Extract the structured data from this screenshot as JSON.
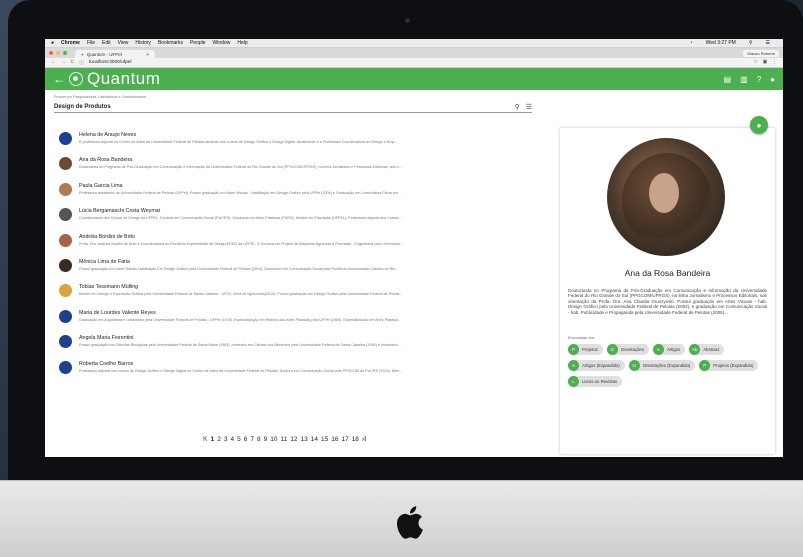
{
  "menubar": {
    "app": "Chrome",
    "items": [
      "File",
      "Edit",
      "View",
      "History",
      "Bookmarks",
      "People",
      "Window",
      "Help"
    ],
    "clock": "Wed 3:27 PM"
  },
  "browser": {
    "tab_title": "Quantum - UFPel",
    "profile_name": "Glauco Roberto",
    "url": "localhost:3000/ufpel"
  },
  "appbar": {
    "brand": "Quantum"
  },
  "search": {
    "label": "Procure por Pesquisadores, Laboratórios e Conhecimentos",
    "value": "Design de Produtos"
  },
  "results": [
    {
      "name": "Helena de Araujo Neves",
      "desc": "É professora adjunta no Centro de Artes da Universidade Federal de Pelotas atuando nos cursos de Design Gráfico e Design Digital. Atualmente é a Professora Coordenadora do Design e Emp...",
      "avatar": "#1f3f8f"
    },
    {
      "name": "Ana da Rosa Bandeira",
      "desc": "Doutoranda no Programa de Pós-Graduação em Comunicação e Informação da Universidade Federal do Rio Grande do Sul (PPGCOM/UFRGS), na linha Jornalismo e Processos Editoriais, sob o...",
      "avatar": "#6b4a35"
    },
    {
      "name": "Paula Garcia Lima",
      "desc": "Professora assistente da Universidade Federal de Pelotas (UFPel). Possui graduação em Artes Visuais - Habilitação em Design Gráfico pela UFPel (2004) e Graduação em Licenciatura Plena em...",
      "avatar": "#b07a55"
    },
    {
      "name": "Lúcia Bergamaschi Costa Weymar",
      "desc": "Coordenadora dos Cursos de Design da UFPEL. Doutora em Comunicação Social (PUCRS). Graduada em Artes Plásticas (FURG). Mestre em Educação (UFPEL). Professora adjunta dos Cursos ...",
      "avatar": "#555555"
    },
    {
      "name": "Andréia Bordini de Brito",
      "desc": "Profa. Dra. Andréia Bordini de Brito é Coordenadora do Escritório experimental de Design-EEDG da UFPEL. É Doutora em Projeto de Máquinas Agrícolas e Florestais - Engenharia pela Universida...",
      "avatar": "#a8644a"
    },
    {
      "name": "Mônica Lima de Faria",
      "desc": "Possui graduação em Artes Visuais Habilitação Em Design Gráfico pela Universidade Federal de Pelotas (2004), Doutorado em Comunicação Social pela Pontifícia Universidade Católica do Rio...",
      "avatar": "#3a2a24"
    },
    {
      "name": "Tobias Tessmann Mülling",
      "desc": "Mestre em Design e Expressão Gráfica pela Universidade Federal de Santa Catarina - UFSC, linha de hipermídia(2010). Possui graduação em Design Gráfico pela Universidade Federal de Pelota...",
      "avatar": "#d9a23c"
    },
    {
      "name": "Maria de Lourdes Valente Reyes",
      "desc": "Graduação em Arquitetura e Urbanismo pela Universidade Federal de Pelotas - UFPel (1978), Especialização em História das Artes Plásticas pela UFPel (1980), Especialização em Artes Plástica...",
      "avatar": "#1f3f8f"
    },
    {
      "name": "Angela Maria Fiorentini",
      "desc": "Possui graduação em Ciências Biológicas pela Universidade Federal de Santa Maria (1983), mestrado em Ciência dos Alimentos pela Universidade Federal de Santa Catarina (1999) e doutorado...",
      "avatar": "#1f3f8f"
    },
    {
      "name": "Roberta Coelho Barros",
      "desc": "Professora adjunta nos cursos de Design Gráfico e Design Digital do Centro de Artes da Universidade Federal de Pelotas. Doutora em Comunicação Social pela PPGCOM da PUCRS (2013). Mes...",
      "avatar": "#1f3f8f"
    }
  ],
  "pagination": {
    "first": "K",
    "pages": [
      "1",
      "2",
      "3",
      "4",
      "5",
      "6",
      "7",
      "8",
      "9",
      "10",
      "11",
      "12",
      "13",
      "14",
      "15",
      "16",
      "17",
      "18"
    ],
    "last": "›I"
  },
  "profile": {
    "name": "Ana da Rosa Bandeira",
    "description": "Doutoranda no Programa de Pós-Graduação em Comunicação e Informação da Universidade Federal do Rio Grande do Sul (PPGCOM/UFRGS), na linha Jornalismo e Processos Editoriais, sob orientação da Profa. Dra. Ana Claudia Gruszynski. Possui graduação em Artes Visuais - hab. Design Gráfico pela Universidade Federal de Pelotas (2002), e graduação em Comunicação Social - hab. Publicidade e Propaganda pela Universidade Federal de Pelotas (2005)...",
    "found_in_label": "Encontrado em:",
    "chips": [
      {
        "icon": "P",
        "label": "Projetos"
      },
      {
        "icon": "O",
        "label": "Orientações"
      },
      {
        "icon": "A",
        "label": "Artigos"
      },
      {
        "icon": "Ab",
        "label": "Abstract"
      },
      {
        "icon": "A",
        "label": "Artigos (Expandido)"
      },
      {
        "icon": "O",
        "label": "Orientações (Expandido)"
      },
      {
        "icon": "P",
        "label": "Projetos (Expandido)"
      },
      {
        "icon": "L",
        "label": "Livros ou Revistas"
      }
    ]
  },
  "colors": {
    "primary": "#4caf50"
  }
}
